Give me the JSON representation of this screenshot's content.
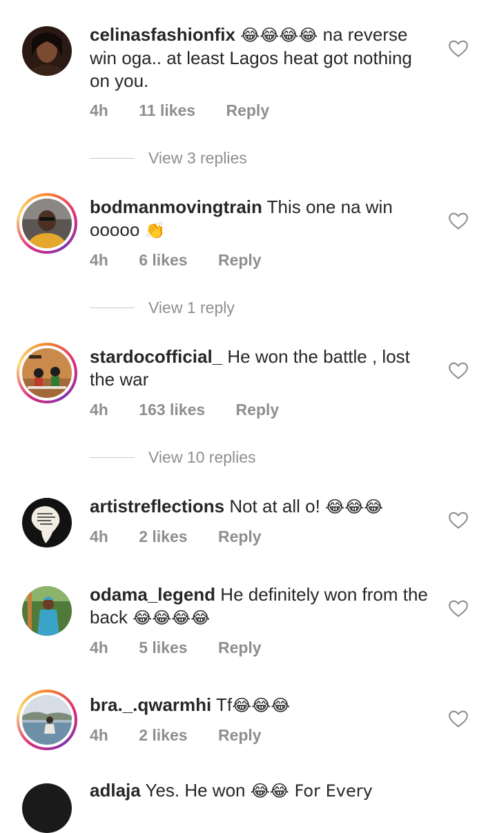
{
  "comments": [
    {
      "username": "celinasfashionfix",
      "emoji_prefix": "😂😂😂😂",
      "text": "na reverse win oga.. at least Lagos heat got nothing on you.",
      "emoji_suffix": "",
      "time": "4h",
      "likes": "11 likes",
      "reply": "Reply",
      "view_replies": "View 3 replies"
    },
    {
      "username": "bodmanmovingtrain",
      "emoji_prefix": "",
      "text": "This one na win ooooo",
      "emoji_suffix": "👏",
      "time": "4h",
      "likes": "6 likes",
      "reply": "Reply",
      "view_replies": "View 1 reply"
    },
    {
      "username": "stardocofficial_",
      "emoji_prefix": "",
      "text": "He won the battle , lost the war",
      "emoji_suffix": "",
      "time": "4h",
      "likes": "163 likes",
      "reply": "Reply",
      "view_replies": "View 10 replies"
    },
    {
      "username": "artistreflections",
      "emoji_prefix": "",
      "text": "Not at all o!",
      "emoji_suffix": "😂😂😂",
      "time": "4h",
      "likes": "2 likes",
      "reply": "Reply",
      "view_replies": ""
    },
    {
      "username": "odama_legend",
      "emoji_prefix": "",
      "text": "He definitely won from the back",
      "emoji_suffix": "😂😂😂😂",
      "time": "4h",
      "likes": "5 likes",
      "reply": "Reply",
      "view_replies": ""
    },
    {
      "username": "bra._.qwarmhi",
      "emoji_prefix": "",
      "text": "Tf",
      "emoji_suffix": "😂😂😂",
      "time": "4h",
      "likes": "2 likes",
      "reply": "Reply",
      "view_replies": ""
    },
    {
      "username": "adlaja",
      "emoji_prefix": "",
      "text": "Yes. He won",
      "emoji_suffix": "😂😂 For Every",
      "time": "",
      "likes": "",
      "reply": "",
      "view_replies": ""
    }
  ],
  "icons": {
    "like": "heart-outline-icon"
  },
  "colors": {
    "text": "#262626",
    "secondary": "#8e8e8e",
    "divider": "#c7c7c7"
  }
}
